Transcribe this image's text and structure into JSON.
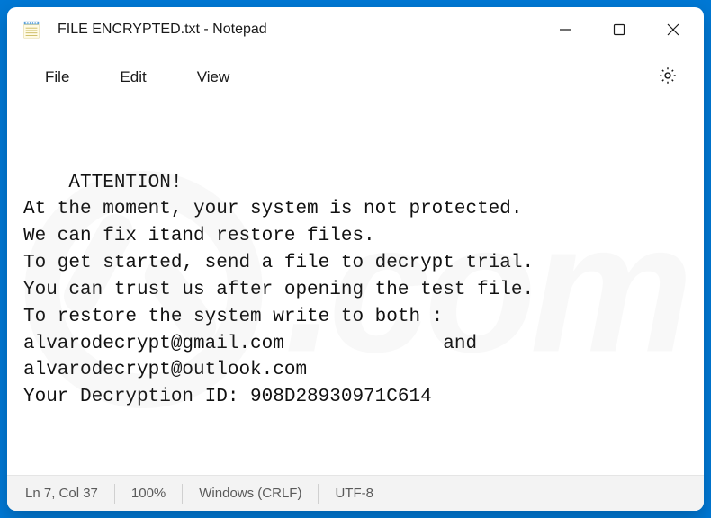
{
  "titlebar": {
    "title": "FILE ENCRYPTED.txt - Notepad"
  },
  "menu": {
    "file": "File",
    "edit": "Edit",
    "view": "View"
  },
  "content": {
    "text": "ATTENTION!\nAt the moment, your system is not protected.\nWe can fix itand restore files.\nTo get started, send a file to decrypt trial.\nYou can trust us after opening the test file.\nTo restore the system write to both :\nalvarodecrypt@gmail.com              and\nalvarodecrypt@outlook.com\nYour Decryption ID: 908D28930971C614"
  },
  "statusbar": {
    "position": "Ln 7, Col 37",
    "zoom": "100%",
    "line_ending": "Windows (CRLF)",
    "encoding": "UTF-8"
  },
  "watermark": {
    "text": ".com"
  }
}
